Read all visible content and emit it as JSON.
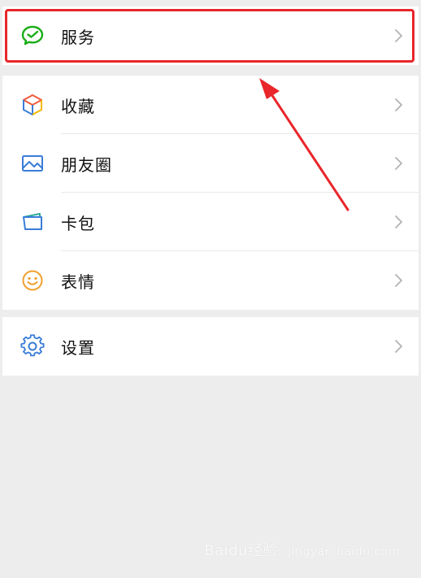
{
  "menu": {
    "service": {
      "label": "服务",
      "icon": "wechat-pay-icon"
    },
    "items": [
      {
        "label": "收藏",
        "icon": "favorites-cube-icon"
      },
      {
        "label": "朋友圈",
        "icon": "moments-image-icon"
      },
      {
        "label": "卡包",
        "icon": "card-wallet-icon"
      },
      {
        "label": "表情",
        "icon": "smiley-icon"
      }
    ],
    "settings": {
      "label": "设置",
      "icon": "gear-icon"
    }
  },
  "annotation": {
    "highlight_color": "#e8262b"
  },
  "watermark": {
    "brand": "Bai",
    "paw": "du",
    "tail": "经验",
    "sub": "jingyan.baidu.com"
  },
  "colors": {
    "background": "#ededed",
    "green": "#1aad19",
    "blue": "#3a7dd8",
    "orange": "#f0a030"
  }
}
